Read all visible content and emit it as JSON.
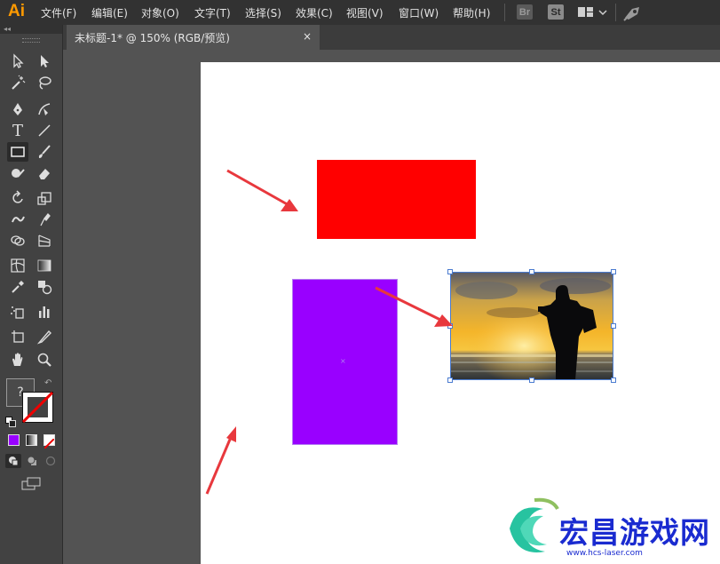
{
  "app": {
    "logo": "Ai"
  },
  "menu": [
    {
      "key": "file",
      "label": "文件(F)"
    },
    {
      "key": "edit",
      "label": "编辑(E)"
    },
    {
      "key": "object",
      "label": "对象(O)"
    },
    {
      "key": "type",
      "label": "文字(T)"
    },
    {
      "key": "select",
      "label": "选择(S)"
    },
    {
      "key": "effect",
      "label": "效果(C)"
    },
    {
      "key": "view",
      "label": "视图(V)"
    },
    {
      "key": "window",
      "label": "窗口(W)"
    },
    {
      "key": "help",
      "label": "帮助(H)"
    }
  ],
  "menubar_icons": {
    "bridge": "Br",
    "stock": "St"
  },
  "document_tab": {
    "title": "未标题-1* @ 150% (RGB/预览)",
    "close": "×"
  },
  "tools": [
    {
      "name": "selection-tool-icon"
    },
    {
      "name": "direct-selection-tool-icon"
    },
    {
      "name": "magic-wand-tool-icon"
    },
    {
      "name": "lasso-tool-icon"
    },
    {
      "name": "pen-tool-icon"
    },
    {
      "name": "curvature-tool-icon"
    },
    {
      "name": "type-tool-icon",
      "glyph": "T"
    },
    {
      "name": "line-segment-tool-icon"
    },
    {
      "name": "rectangle-tool-icon",
      "active": true
    },
    {
      "name": "paintbrush-tool-icon"
    },
    {
      "name": "shaper-tool-icon"
    },
    {
      "name": "eraser-tool-icon"
    },
    {
      "name": "rotate-tool-icon"
    },
    {
      "name": "scale-tool-icon"
    },
    {
      "name": "warp-tool-icon"
    },
    {
      "name": "free-transform-tool-icon"
    },
    {
      "name": "shape-builder-tool-icon"
    },
    {
      "name": "perspective-grid-tool-icon"
    },
    {
      "name": "mesh-tool-icon"
    },
    {
      "name": "gradient-tool-icon"
    },
    {
      "name": "eyedropper-tool-icon"
    },
    {
      "name": "blend-tool-icon"
    },
    {
      "name": "symbol-sprayer-tool-icon"
    },
    {
      "name": "column-graph-tool-icon"
    },
    {
      "name": "artboard-tool-icon"
    },
    {
      "name": "slice-tool-icon"
    },
    {
      "name": "hand-tool-icon"
    },
    {
      "name": "zoom-tool-icon"
    }
  ],
  "fill_stroke": {
    "fill_placeholder": "?"
  },
  "colors": {
    "red_rect": "#ff0000",
    "purple_rect": "#9900ff",
    "arrow": "#e8383d",
    "selection": "#4a7bd0",
    "purple_swatch": "#9900ff"
  },
  "watermark": {
    "text": "宏昌游戏网",
    "url": "www.hcs-laser.com"
  }
}
